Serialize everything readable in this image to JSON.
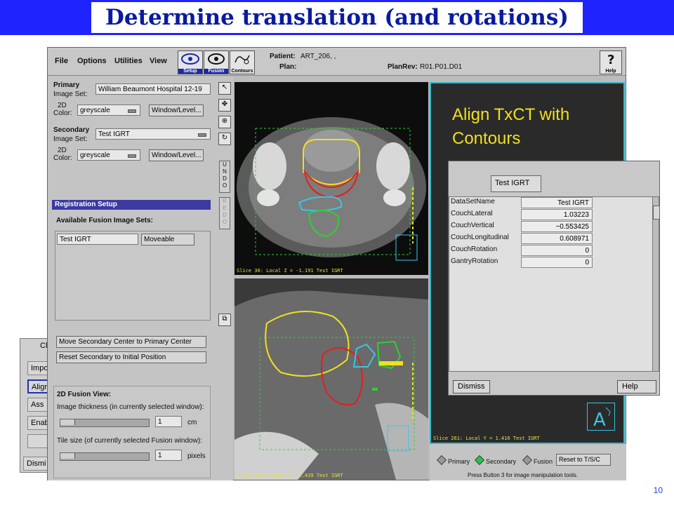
{
  "slide": {
    "title": "Determine translation (and rotations)",
    "page_number": "10"
  },
  "background_window": {
    "title_fragment": "Cl",
    "buttons": [
      "Impo",
      "Align",
      "Ass",
      "Enab",
      ""
    ],
    "dismiss_label": "Dismi"
  },
  "app": {
    "menu": {
      "file": "File",
      "options": "Options",
      "utilities": "Utilities",
      "view": "View"
    },
    "toolbar": {
      "setup": "Setup",
      "fusion": "Fusion",
      "contours": "Contours",
      "help": "Help"
    },
    "patient_label": "Patient:",
    "patient_value": "ART_206, ,",
    "plan_label": "Plan:",
    "planrev_label": "PlanRev:",
    "planrev_value": "R01.P01.D01"
  },
  "left_panel": {
    "primary": "Primary",
    "primary_image_set_label": "Image Set:",
    "primary_image_set_value": "William Beaumont Hospital 12-19",
    "color_label_2d": "2D",
    "color_label": "Color:",
    "primary_color_value": "greyscale",
    "window_level": "Window/Level...",
    "secondary": "Secondary",
    "secondary_image_set_label": "Image Set:",
    "secondary_image_set_value": "Test IGRT",
    "secondary_color_value": "greyscale",
    "registration_setup": "Registration Setup",
    "available_sets": "Available Fusion Image Sets:",
    "fusion_set_name": "Test IGRT",
    "fusion_set_mode": "Moveable",
    "move_center": "Move Secondary Center to Primary Center",
    "reset_secondary": "Reset Secondary to Initial Position",
    "fusion_view_title": "2D Fusion View:",
    "image_thickness_label": "Image thickness (in currently selected window):",
    "thickness_value": "1",
    "thickness_unit": "cm",
    "tile_size_label": "Tile size (of currently selected Fusion window):",
    "tile_value": "1",
    "tile_unit": "pixels"
  },
  "side_tools": {
    "undo": "UNDO",
    "redo": "REDO"
  },
  "scans": {
    "axial_caption": "Slice 30: Local Z = -1.191  Test IGRT",
    "sagittal_caption": "Slice 272: Local X = 2.439  Test IGRT",
    "fusion_caption": "Slice 261: Local Y = 1.416  Test IGRT"
  },
  "fusion_pane": {
    "annotation": "Align TxCT with Contours"
  },
  "fusion_controls": {
    "primary": "Primary",
    "secondary": "Secondary",
    "fusion": "Fusion",
    "reset": "Reset to T/S/C",
    "hint": "Press Button 3 for image manipulation tools."
  },
  "dialog": {
    "field_value": "Test IGRT",
    "rows": [
      {
        "key": "DataSetName",
        "value": "Test IGRT"
      },
      {
        "key": "CouchLateral",
        "value": "1.03223"
      },
      {
        "key": "CouchVertical",
        "value": "−0.553425"
      },
      {
        "key": "CouchLongitudinal",
        "value": "0.608971"
      },
      {
        "key": "CouchRotation",
        "value": "0"
      },
      {
        "key": "GantryRotation",
        "value": "0"
      }
    ],
    "dismiss": "Dismiss",
    "help": "Help"
  },
  "colors": {
    "title_bar": "#1f24ff",
    "title_text": "#0a1aa0",
    "contour_bladder": "#f0e020",
    "contour_prostate": "#e02020",
    "contour_cyan": "#36c6e6",
    "contour_rectum": "#30d030",
    "annotation_text": "#f0e020"
  }
}
